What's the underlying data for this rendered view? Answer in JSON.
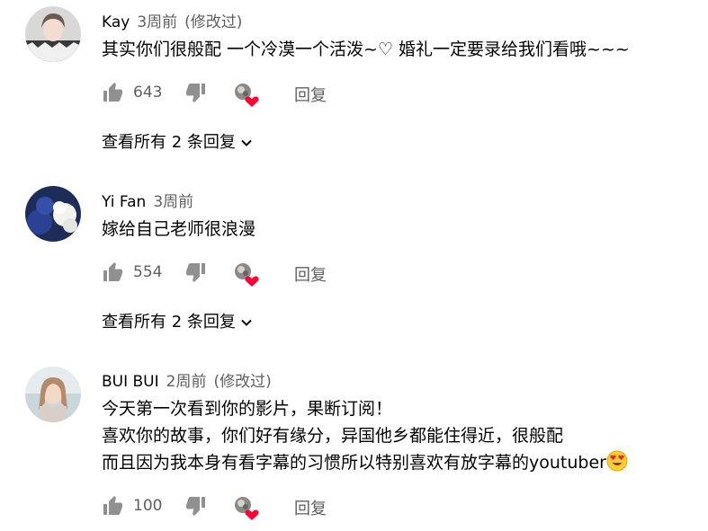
{
  "comments": [
    {
      "author": "Kay",
      "time": "3周前",
      "edited": "(修改过)",
      "lines": [
        "其实你们很般配 一个冷漠一个活泼~♡ 婚礼一定要录给我们看哦~~~"
      ],
      "likes": "643",
      "reply_label": "回复",
      "view_replies": "查看所有 2 条回复",
      "liked_by_creator": true
    },
    {
      "author": "Yi Fan",
      "time": "3周前",
      "edited": "",
      "lines": [
        "嫁给自己老师很浪漫"
      ],
      "likes": "554",
      "reply_label": "回复",
      "view_replies": "查看所有 2 条回复",
      "liked_by_creator": true
    },
    {
      "author": "BUI BUI",
      "time": "2周前",
      "edited": "(修改过)",
      "lines": [
        "今天第一次看到你的影片，果断订阅！",
        "喜欢你的故事，你们好有缘分，异国他乡都能住得近，很般配",
        "而且因为我本身有看字幕的习惯所以特别喜欢有放字幕的youtuber"
      ],
      "emoji": "heart-eyes-emoji",
      "likes": "100",
      "reply_label": "回复",
      "liked_by_creator": true
    }
  ],
  "icons": {
    "like": "thumbs-up-icon",
    "dislike": "thumbs-down-icon",
    "creator_heart": "creator-heart-icon",
    "expand": "chevron-down-icon"
  },
  "colors": {
    "text_primary": "#030303",
    "text_secondary": "#606060",
    "heart": "#ff0033"
  }
}
